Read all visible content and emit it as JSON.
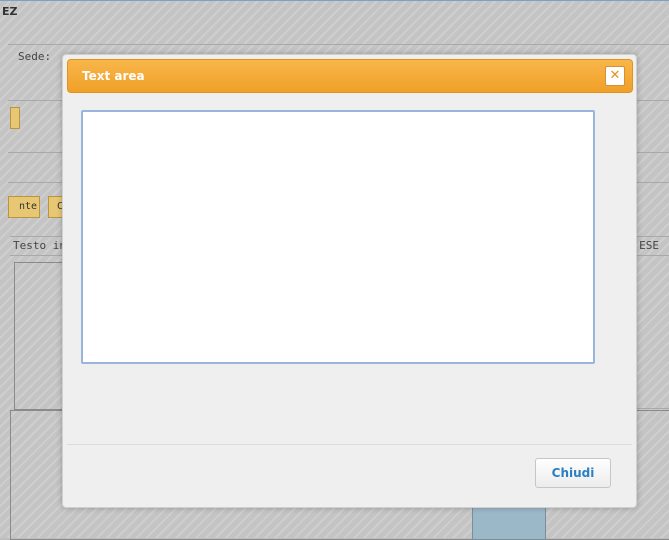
{
  "background": {
    "title": "EZ",
    "sede_label": "Sede:",
    "button_1": "nte",
    "button_2": "C",
    "column_left": "Testo in",
    "column_right": "ESE"
  },
  "dialog": {
    "title": "Text area",
    "close_icon": "close-icon",
    "textarea_value": "",
    "close_button_label": "Chiudi"
  },
  "colors": {
    "titlebar": "#f0a028",
    "button_text": "#2b7fc4",
    "textarea_border": "#99b5dc"
  }
}
